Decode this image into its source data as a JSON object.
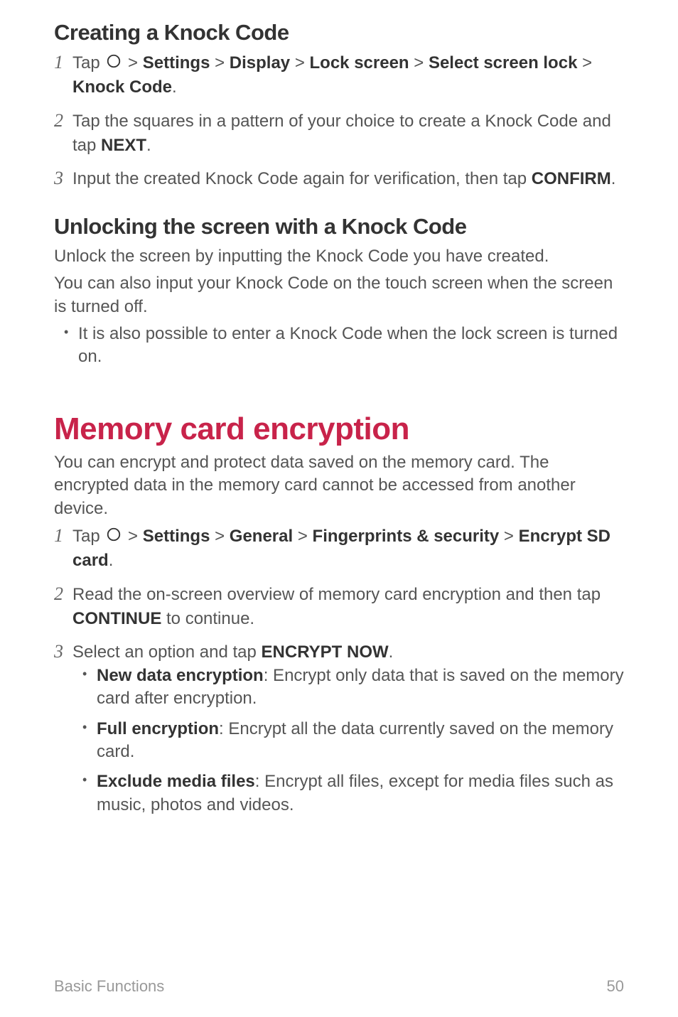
{
  "section1": {
    "heading": "Creating a Knock Code",
    "steps": [
      {
        "num": "1",
        "pre": "Tap ",
        "icon": "home-icon",
        "path": " Settings   Display   Lock screen   Select screen lock   Knock Code",
        "end": "."
      },
      {
        "num": "2",
        "text_pre": "Tap the squares in a pattern of your choice to create a Knock Code and tap ",
        "bold": "NEXT",
        "text_post": "."
      },
      {
        "num": "3",
        "text_pre": "Input the created Knock Code again for verification, then tap ",
        "bold": "CONFIRM",
        "text_post": "."
      }
    ]
  },
  "section2": {
    "heading": "Unlocking the screen with a Knock Code",
    "p1": "Unlock the screen by inputting the Knock Code you have created.",
    "p2": "You can also input your Knock Code on the touch screen when the screen is turned off.",
    "bullet1": "It is also possible to enter a Knock Code when the lock screen is turned on."
  },
  "main": {
    "heading": "Memory card encryption",
    "intro": "You can encrypt and protect data saved on the memory card. The encrypted data in the memory card cannot be accessed from another device.",
    "steps": [
      {
        "num": "1",
        "pre": "Tap ",
        "icon": "home-icon",
        "path": " Settings   General   Fingerprints & security   Encrypt SD card",
        "end": "."
      },
      {
        "num": "2",
        "text_pre": "Read the on-screen overview of memory card encryption and then tap ",
        "bold": "CONTINUE",
        "text_post": " to continue."
      },
      {
        "num": "3",
        "text_pre": "Select an option and tap ",
        "bold": "ENCRYPT NOW",
        "text_post": ".",
        "sub": [
          {
            "bold": "New data encryption",
            "rest": ": Encrypt only data that is saved on the memory card after encryption."
          },
          {
            "bold": "Full encryption",
            "rest": ": Encrypt all the data currently saved on the memory card."
          },
          {
            "bold": "Exclude media files",
            "rest": ": Encrypt all files, except for media files such as music, photos and videos."
          }
        ]
      }
    ]
  },
  "footer": {
    "left": "Basic Functions",
    "right": "50"
  },
  "nav_paths": {
    "s1_step1": {
      "p1": "Settings",
      "p2": "Display",
      "p3": "Lock screen",
      "p4": "Select screen lock",
      "p5": "Knock Code"
    },
    "m_step1": {
      "p1": "Settings",
      "p2": "General",
      "p3": "Fingerprints & security",
      "p4": "Encrypt SD card"
    }
  }
}
